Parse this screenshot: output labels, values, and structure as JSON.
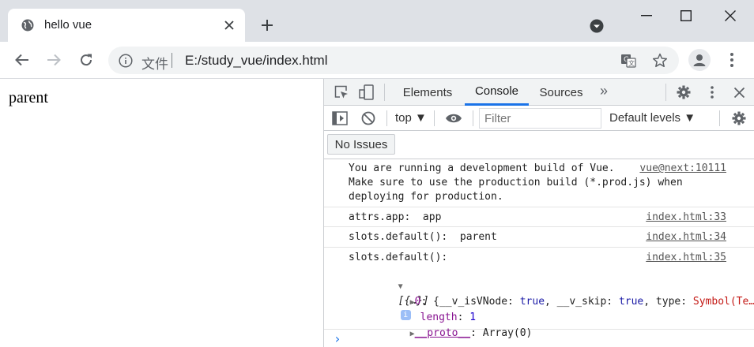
{
  "browser": {
    "tab_title": "hello vue",
    "omnibox_protocol": "文件",
    "omnibox_url": "E:/study_vue/index.html"
  },
  "page": {
    "content_text": "parent"
  },
  "devtools": {
    "tabs": [
      "Elements",
      "Console",
      "Sources"
    ],
    "active_tab": "Console",
    "more_tabs_symbol": "»",
    "context": "top ▼",
    "filter_placeholder": "Filter",
    "levels": "Default levels ▼",
    "issues_button": "No Issues"
  },
  "console": {
    "messages": [
      {
        "text": "You are running a development build of Vue.\nMake sure to use the production build (*.prod.js) when\ndeploying for production.",
        "source": "vue@next:10111"
      },
      {
        "text": "attrs.app:  app",
        "source": "index.html:33"
      },
      {
        "text": "slots.default():  parent",
        "source": "index.html:34"
      },
      {
        "text": "slots.default():",
        "source": "index.html:35"
      }
    ],
    "array_preview": "[{…}]",
    "item0_key": "0",
    "item0_preview_1": "{__v_isVNode: ",
    "item0_true_1": "true",
    "item0_preview_2": ", __v_skip: ",
    "item0_true_2": "true",
    "item0_preview_3": ", type: ",
    "item0_symbol": "Symbol(Te…",
    "length_key": "length",
    "length_value": "1",
    "proto_key": "__proto__",
    "proto_value": "Array(0)"
  },
  "colors": {
    "accent": "#1a73e8",
    "tabstrip": "#dee1e6",
    "omnibox": "#f1f3f4"
  }
}
